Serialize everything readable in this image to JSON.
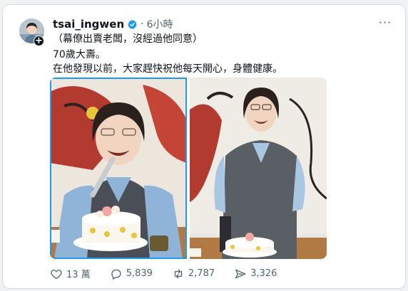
{
  "post": {
    "username": "tsai_ingwen",
    "separator": "·",
    "time": "6小時",
    "more_label": "···",
    "follow_label": "+",
    "lines": [
      "（幕僚出賣老闆，沒經過他同意）",
      "70歲大壽。",
      "在他發現以前，大家趕快祝他每天開心，身體健康。"
    ]
  },
  "actions": {
    "likes": "13 萬",
    "replies": "5,839",
    "reposts": "2,787",
    "views": "3,326"
  },
  "colors": {
    "accent": "#1d9bf0",
    "text": "#0f1419",
    "muted": "#536471"
  }
}
